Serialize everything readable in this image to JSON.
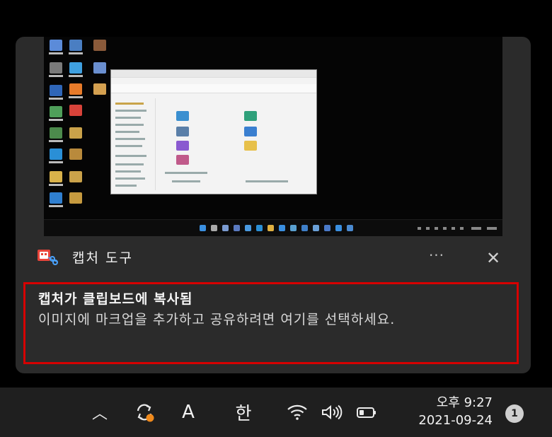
{
  "toast": {
    "app_name": "캡처 도구",
    "more_label": "···",
    "close_label": "✕",
    "message_title": "캡처가 클립보드에 복사됨",
    "message_body": "이미지에 마크업을 추가하고 공유하려면 여기를 선택하세요."
  },
  "taskbar": {
    "chevron_label": "︿",
    "ime_mode": "A",
    "ime_lang": "한",
    "time": "오후 9:27",
    "date": "2021-09-24",
    "notification_count": "1"
  },
  "colors": {
    "highlight_border": "#d60000",
    "toast_bg": "#2b2b2b",
    "taskbar_bg": "#1f1f1f"
  },
  "icons": {
    "app": "snipping-tool-icon",
    "sync": "sync-icon",
    "wifi": "wifi-icon",
    "volume": "volume-icon",
    "battery": "battery-icon"
  }
}
